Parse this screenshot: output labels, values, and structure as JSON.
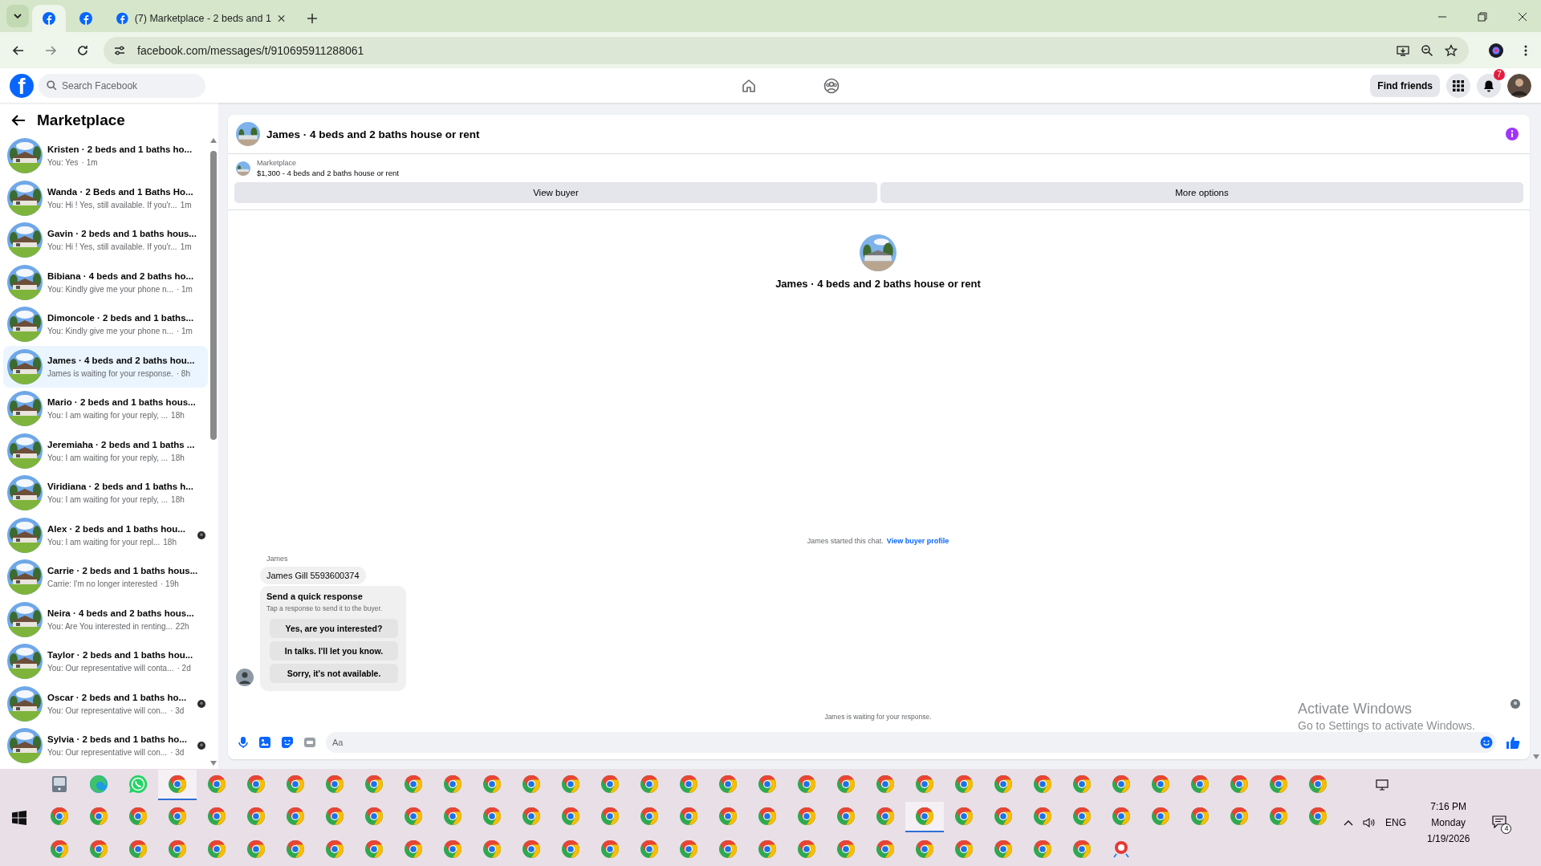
{
  "browser": {
    "tabs": [
      {
        "kind": "icon",
        "selected": true
      },
      {
        "kind": "icon",
        "selected": false
      },
      {
        "kind": "titled",
        "title": "(7) Marketplace - 2 beds and 1",
        "selected": false
      }
    ],
    "url": "facebook.com/messages/t/910695911288061"
  },
  "facebook": {
    "logo_letter": "f",
    "search_placeholder": "Search Facebook",
    "find_friends": "Find friends",
    "notification_count": "7"
  },
  "sidebar": {
    "title": "Marketplace",
    "conversations": [
      {
        "title": "Kristen · 2 beds and 1 baths ho...",
        "preview": "You: Yes",
        "time": "· 1m",
        "selected": false,
        "seen": false
      },
      {
        "title": "Wanda · 2 Beds and 1 Baths Ho...",
        "preview": "You: Hi ! Yes, still available. If you'r...",
        "time": "1m",
        "selected": false,
        "seen": false
      },
      {
        "title": "Gavin · 2 beds and 1 baths hous...",
        "preview": "You: Hi ! Yes, still available. If you'r...",
        "time": "1m",
        "selected": false,
        "seen": false
      },
      {
        "title": "Bibiana · 4 beds and 2 baths ho...",
        "preview": "You: Kindly give me your phone n...",
        "time": "· 1m",
        "selected": false,
        "seen": false
      },
      {
        "title": "Dimoncole · 2 beds and 1 baths...",
        "preview": "You: Kindly give me your phone n...",
        "time": "· 1m",
        "selected": false,
        "seen": false
      },
      {
        "title": "James · 4 beds and 2 baths hou...",
        "preview": "James is waiting for your response.",
        "time": "· 8h",
        "selected": true,
        "seen": false
      },
      {
        "title": "Mario · 2 beds and 1 baths hous...",
        "preview": "You: I am waiting for your reply, ...",
        "time": "18h",
        "selected": false,
        "seen": false
      },
      {
        "title": "Jeremiaha · 2 beds and 1 baths ...",
        "preview": "You: I am waiting for your reply, ...",
        "time": "18h",
        "selected": false,
        "seen": false
      },
      {
        "title": "Viridiana · 2 beds and 1 baths h...",
        "preview": "You: I am waiting for your reply, ...",
        "time": "18h",
        "selected": false,
        "seen": false
      },
      {
        "title": "Alex · 2 beds and 1 baths hou...",
        "preview": "You: I am waiting for your repl...",
        "time": "18h",
        "selected": false,
        "seen": true
      },
      {
        "title": "Carrie · 2 beds and 1 baths hous...",
        "preview": "Carrie: I'm no longer interested",
        "time": "· 19h",
        "selected": false,
        "seen": false
      },
      {
        "title": "Neira · 4 beds and 2 baths hous...",
        "preview": "You: Are You interested in renting...",
        "time": "22h",
        "selected": false,
        "seen": false
      },
      {
        "title": "Taylor · 2 beds and 1 baths hou...",
        "preview": "You: Our representative will conta...",
        "time": "· 2d",
        "selected": false,
        "seen": false
      },
      {
        "title": "Oscar · 2 beds and 1 baths ho...",
        "preview": "You: Our representative will con...",
        "time": "· 3d",
        "selected": false,
        "seen": true
      },
      {
        "title": "Sylvia · 2 beds and 1 baths ho...",
        "preview": "You: Our representative will con...",
        "time": "· 3d",
        "selected": false,
        "seen": true
      }
    ]
  },
  "chat": {
    "title": "James · 4 beds and 2 baths house or rent",
    "listing_label": "Marketplace",
    "listing": "$1,300 - 4 beds and 2 baths house or rent",
    "buttons": [
      "View buyer",
      "More options"
    ],
    "intro_title": "James · 4 beds and 2 baths house or rent",
    "started": "James started this chat.",
    "started_link": "View buyer profile",
    "sender": "James",
    "message": "James Gill 5593600374",
    "quick": {
      "title": "Send a quick response",
      "hint": "Tap a response to send it to the buyer.",
      "options": [
        "Yes, are you interested?",
        "In talks. I'll let you know.",
        "Sorry, it's not available."
      ]
    },
    "status": "James is waiting for your response.",
    "composer_placeholder": "Aa"
  },
  "os_notice": {
    "title": "Activate Windows",
    "text": "Go to Settings to activate Windows."
  },
  "taskbar": {
    "rows": [
      [
        {
          "kind": "drive",
          "selected": false
        },
        {
          "kind": "edge",
          "selected": false
        },
        {
          "kind": "whatsapp",
          "selected": false
        },
        {
          "kind": "chrome",
          "selected": true
        },
        {
          "kind": "chrome",
          "selected": false
        },
        {
          "kind": "chrome",
          "selected": false
        },
        {
          "kind": "chrome",
          "selected": false
        },
        {
          "kind": "chrome",
          "selected": false
        },
        {
          "kind": "chrome",
          "selected": false
        },
        {
          "kind": "chrome",
          "selected": false
        },
        {
          "kind": "chrome",
          "selected": false
        },
        {
          "kind": "chrome",
          "selected": false
        },
        {
          "kind": "chrome",
          "selected": false
        },
        {
          "kind": "chrome",
          "selected": false
        },
        {
          "kind": "chrome",
          "selected": false
        },
        {
          "kind": "chrome",
          "selected": false
        },
        {
          "kind": "chrome",
          "selected": false
        },
        {
          "kind": "chrome",
          "selected": false
        },
        {
          "kind": "chrome",
          "selected": false
        },
        {
          "kind": "chrome",
          "selected": false
        },
        {
          "kind": "chrome",
          "selected": false
        },
        {
          "kind": "chrome",
          "selected": false
        },
        {
          "kind": "chrome",
          "selected": false
        },
        {
          "kind": "chrome",
          "selected": false
        },
        {
          "kind": "chrome",
          "selected": false
        },
        {
          "kind": "chrome",
          "selected": false
        },
        {
          "kind": "chrome",
          "selected": false
        },
        {
          "kind": "chrome",
          "selected": false
        },
        {
          "kind": "chrome",
          "selected": false
        },
        {
          "kind": "chrome",
          "selected": false
        },
        {
          "kind": "chrome",
          "selected": false
        },
        {
          "kind": "chrome",
          "selected": false
        },
        {
          "kind": "chrome",
          "selected": false
        }
      ],
      [
        {
          "kind": "chrome",
          "selected": false
        },
        {
          "kind": "chrome",
          "selected": false
        },
        {
          "kind": "chrome",
          "selected": false
        },
        {
          "kind": "chrome",
          "selected": false
        },
        {
          "kind": "chrome",
          "selected": false
        },
        {
          "kind": "chrome",
          "selected": false
        },
        {
          "kind": "chrome",
          "selected": false
        },
        {
          "kind": "chrome",
          "selected": false
        },
        {
          "kind": "chrome",
          "selected": false
        },
        {
          "kind": "chrome",
          "selected": false
        },
        {
          "kind": "chrome",
          "selected": false
        },
        {
          "kind": "chrome",
          "selected": false
        },
        {
          "kind": "chrome",
          "selected": false
        },
        {
          "kind": "chrome",
          "selected": false
        },
        {
          "kind": "chrome",
          "selected": false
        },
        {
          "kind": "chrome",
          "selected": false
        },
        {
          "kind": "chrome",
          "selected": false
        },
        {
          "kind": "chrome",
          "selected": false
        },
        {
          "kind": "chrome",
          "selected": false
        },
        {
          "kind": "chrome",
          "selected": false
        },
        {
          "kind": "chrome",
          "selected": false
        },
        {
          "kind": "chrome",
          "selected": false
        },
        {
          "kind": "chrome",
          "selected": true
        },
        {
          "kind": "chrome",
          "selected": false
        },
        {
          "kind": "chrome",
          "selected": false
        },
        {
          "kind": "chrome",
          "selected": false
        },
        {
          "kind": "chrome",
          "selected": false
        },
        {
          "kind": "chrome",
          "selected": false
        },
        {
          "kind": "chrome",
          "selected": false
        },
        {
          "kind": "chrome",
          "selected": false
        },
        {
          "kind": "chrome",
          "selected": false
        },
        {
          "kind": "chrome",
          "selected": false
        },
        {
          "kind": "chrome",
          "selected": false
        }
      ],
      [
        {
          "kind": "chrome",
          "selected": false
        },
        {
          "kind": "chrome",
          "selected": false
        },
        {
          "kind": "chrome",
          "selected": false
        },
        {
          "kind": "chrome",
          "selected": false
        },
        {
          "kind": "chrome",
          "selected": false
        },
        {
          "kind": "chrome",
          "selected": false
        },
        {
          "kind": "chrome",
          "selected": false
        },
        {
          "kind": "chrome",
          "selected": false
        },
        {
          "kind": "chrome",
          "selected": false
        },
        {
          "kind": "chrome",
          "selected": false
        },
        {
          "kind": "chrome",
          "selected": false
        },
        {
          "kind": "chrome",
          "selected": false
        },
        {
          "kind": "chrome",
          "selected": false
        },
        {
          "kind": "chrome",
          "selected": false
        },
        {
          "kind": "chrome",
          "selected": false
        },
        {
          "kind": "chrome",
          "selected": false
        },
        {
          "kind": "chrome",
          "selected": false
        },
        {
          "kind": "chrome",
          "selected": false
        },
        {
          "kind": "chrome",
          "selected": false
        },
        {
          "kind": "chrome",
          "selected": false
        },
        {
          "kind": "chrome",
          "selected": false
        },
        {
          "kind": "chrome",
          "selected": false
        },
        {
          "kind": "chrome",
          "selected": false
        },
        {
          "kind": "chrome",
          "selected": false
        },
        {
          "kind": "chrome",
          "selected": false
        },
        {
          "kind": "chrome",
          "selected": false
        },
        {
          "kind": "chrome",
          "selected": false
        },
        {
          "kind": "paint",
          "selected": false
        }
      ]
    ],
    "language": "ENG",
    "time": "7:16 PM",
    "day": "Monday",
    "date": "1/19/2026",
    "notification_count": "4"
  }
}
